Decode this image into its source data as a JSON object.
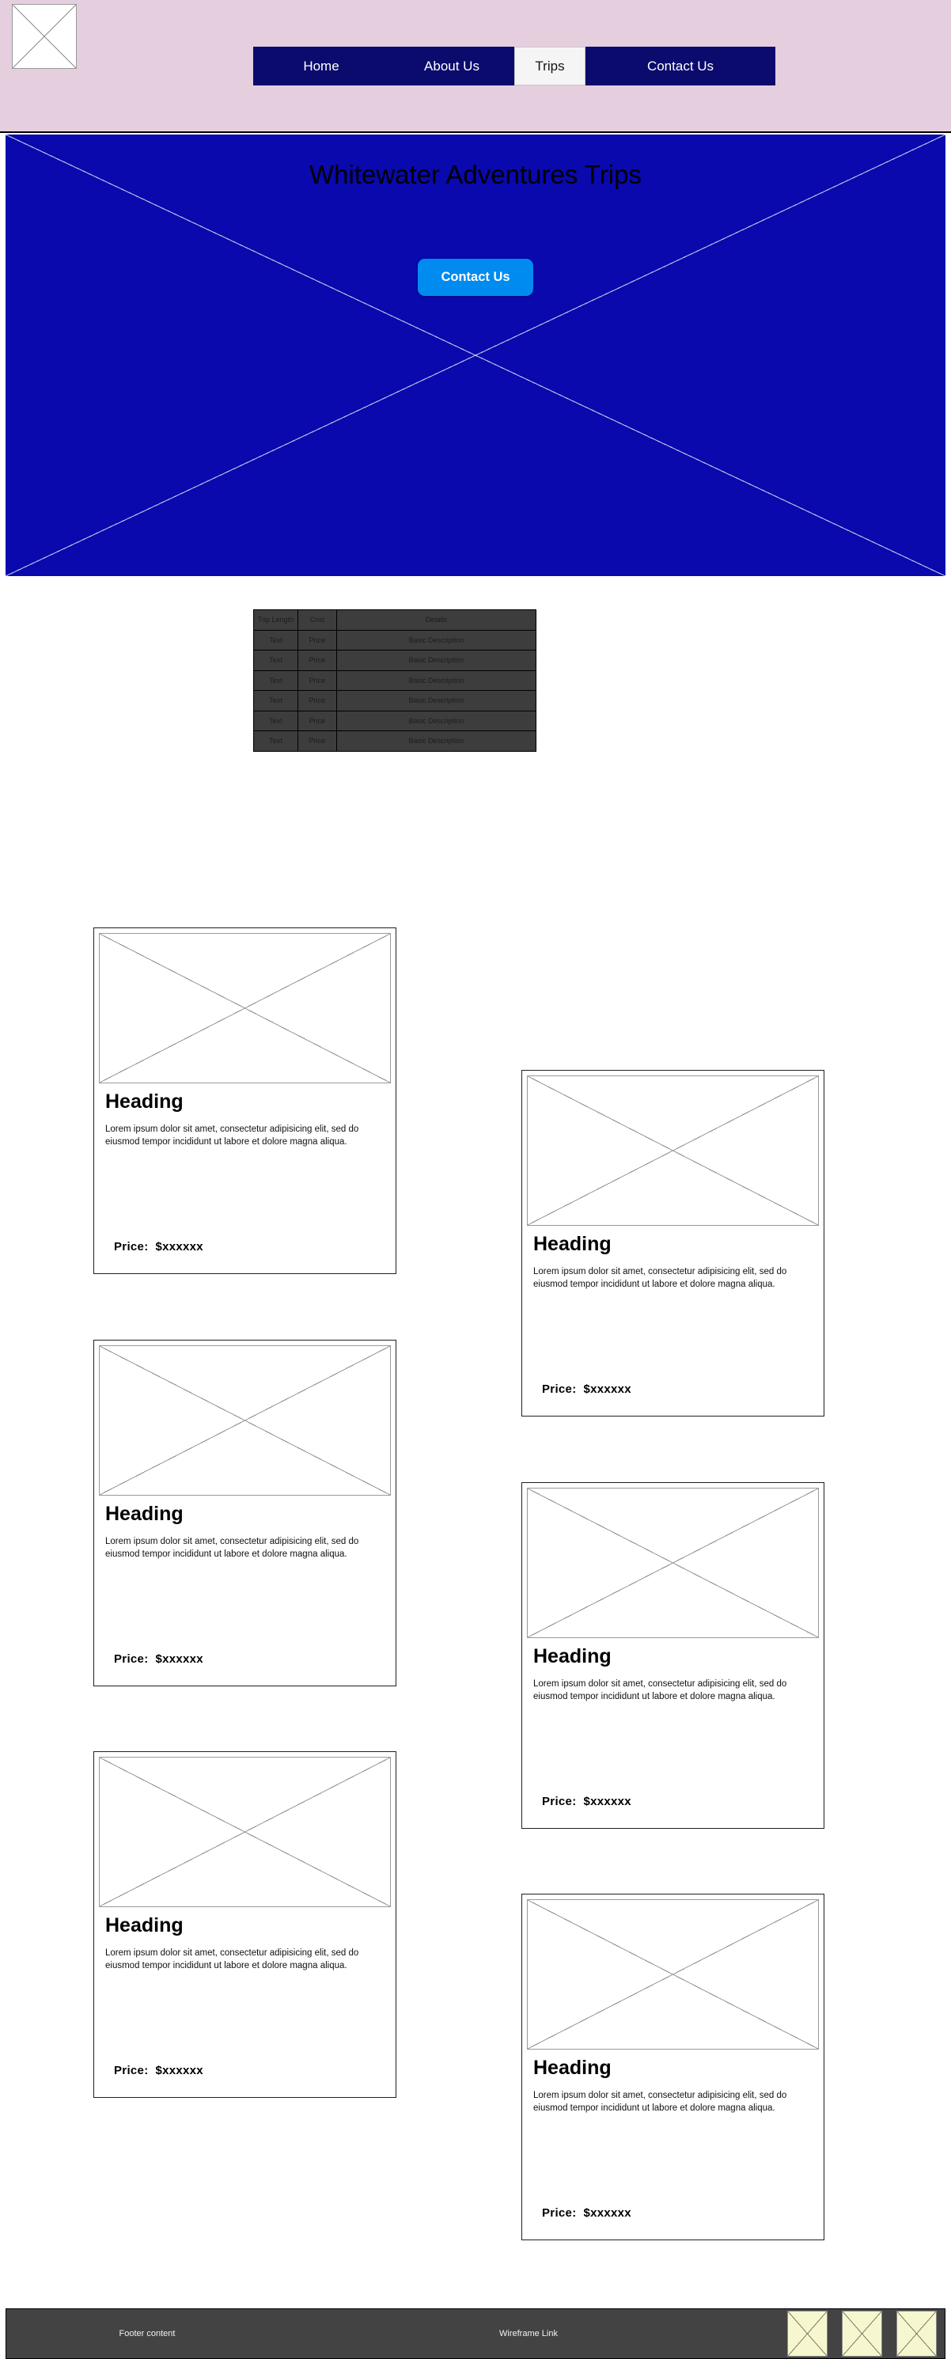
{
  "colors": {
    "header_bg": "#e5cfdf",
    "nav_bg": "#0b0b6e",
    "nav_active_bg": "#f5f5f5",
    "hero_bg": "#0909ad",
    "button_accent": "#008bf0",
    "table_bg": "#3d3d3d",
    "footer_bg": "#434343",
    "thumb_bg": "#f7f7cf"
  },
  "header": {
    "logo": "logo-placeholder-image",
    "nav": [
      {
        "label": "Home",
        "active": false
      },
      {
        "label": "About Us",
        "active": false
      },
      {
        "label": "Trips",
        "active": true
      },
      {
        "label": "Contact Us",
        "active": false
      }
    ]
  },
  "hero": {
    "title": "Whitewater Adventures Trips",
    "cta_label": "Contact Us",
    "placeholder": "hero-placeholder-image"
  },
  "table": {
    "headers": [
      "Trip Length",
      "Cost",
      "Details"
    ],
    "rows": [
      [
        "Text",
        "Price",
        "Basic Description"
      ],
      [
        "Text",
        "Price",
        "Basic Description"
      ],
      [
        "Text",
        "Price",
        "Basic Description"
      ],
      [
        "Text",
        "Price",
        "Basic Description"
      ],
      [
        "Text",
        "Price",
        "Basic Description"
      ],
      [
        "Text",
        "Price",
        "Basic Description"
      ]
    ]
  },
  "cards": [
    {
      "heading": "Heading",
      "text": "Lorem ipsum dolor sit amet, consectetur adipisicing elit, sed do eiusmod tempor incididunt ut labore et dolore magna aliqua.",
      "price_label": "Price:",
      "price_value": "$xxxxxx",
      "image": "card-placeholder-image"
    },
    {
      "heading": "Heading",
      "text": "Lorem ipsum dolor sit amet, consectetur adipisicing elit, sed do eiusmod tempor incididunt ut labore et dolore magna aliqua.",
      "price_label": "Price:",
      "price_value": "$xxxxxx",
      "image": "card-placeholder-image"
    },
    {
      "heading": "Heading",
      "text": "Lorem ipsum dolor sit amet, consectetur adipisicing elit, sed do eiusmod tempor incididunt ut labore et dolore magna aliqua.",
      "price_label": "Price:",
      "price_value": "$xxxxxx",
      "image": "card-placeholder-image"
    },
    {
      "heading": "Heading",
      "text": "Lorem ipsum dolor sit amet, consectetur adipisicing elit, sed do eiusmod tempor incididunt ut labore et dolore magna aliqua.",
      "price_label": "Price:",
      "price_value": "$xxxxxx",
      "image": "card-placeholder-image"
    },
    {
      "heading": "Heading",
      "text": "Lorem ipsum dolor sit amet, consectetur adipisicing elit, sed do eiusmod tempor incididunt ut labore et dolore magna aliqua.",
      "price_label": "Price:",
      "price_value": "$xxxxxx",
      "image": "card-placeholder-image"
    },
    {
      "heading": "Heading",
      "text": "Lorem ipsum dolor sit amet, consectetur adipisicing elit, sed do eiusmod tempor incididunt ut labore et dolore magna aliqua.",
      "price_label": "Price:",
      "price_value": "$xxxxxx",
      "image": "card-placeholder-image"
    }
  ],
  "footer": {
    "content_label": "Footer content",
    "link_label": "Wireframe Link",
    "thumbs": [
      "footer-placeholder-image",
      "footer-placeholder-image",
      "footer-placeholder-image"
    ]
  }
}
